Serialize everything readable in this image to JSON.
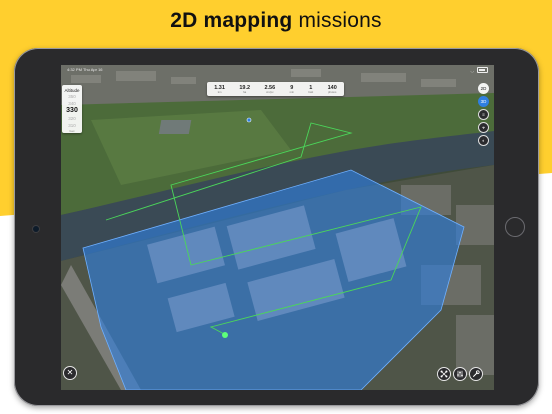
{
  "headline": {
    "bold": "2D mapping",
    "rest": "missions"
  },
  "colors": {
    "brand_yellow": "#ffcf2e",
    "survey_blue": "#2f7fe0",
    "flight_path": "#4bd65a"
  },
  "status_bar": {
    "time": "4:32 PM",
    "date": "Thu Apr 16"
  },
  "telemetry": [
    {
      "value": "1.31",
      "label": "km"
    },
    {
      "value": "19.2",
      "label": "ha"
    },
    {
      "value": "2.56",
      "label": "cm/px"
    },
    {
      "value": "9",
      "label": "min"
    },
    {
      "value": "1",
      "label": "batt"
    },
    {
      "value": "140",
      "label": "photos"
    }
  ],
  "altitude": {
    "title": "Altitude",
    "above2": "350",
    "above1": "340",
    "current": "330",
    "below1": "320",
    "below2": "310",
    "unit": "feet"
  },
  "rail": [
    {
      "label": "2D",
      "icon": "2d-toggle-icon"
    },
    {
      "label": "3D",
      "icon": "3d-toggle-icon"
    },
    {
      "label": "≡",
      "icon": "layers-icon"
    },
    {
      "label": "⌖",
      "icon": "locate-icon"
    },
    {
      "label": "◐",
      "icon": "map-style-icon"
    }
  ],
  "close_label": "✕",
  "tools": [
    "drone-icon",
    "settings-sliders-icon",
    "wrench-icon"
  ]
}
